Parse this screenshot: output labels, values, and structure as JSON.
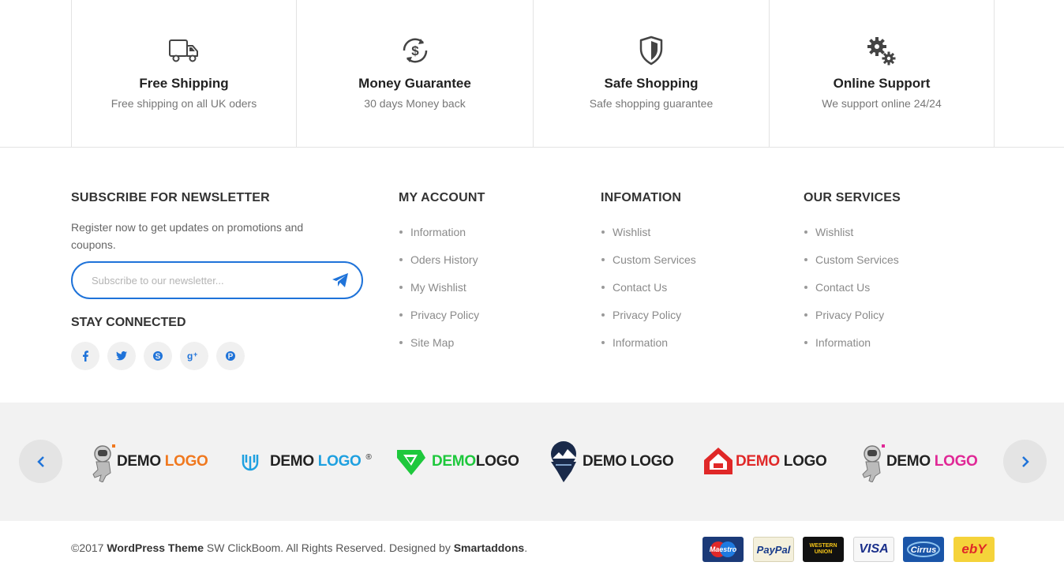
{
  "features": [
    {
      "title": "Free Shipping",
      "desc": "Free shipping on all UK oders",
      "icon": "truck-icon"
    },
    {
      "title": "Money Guarantee",
      "desc": "30 days Money back",
      "icon": "money-back-icon"
    },
    {
      "title": "Safe Shopping",
      "desc": "Safe shopping guarantee",
      "icon": "shield-icon"
    },
    {
      "title": "Online Support",
      "desc": "We support online 24/24",
      "icon": "gears-icon"
    }
  ],
  "newsletter": {
    "title": "SUBSCRIBE FOR NEWSLETTER",
    "text": "Register now to get updates on promotions and coupons.",
    "placeholder": "Subscribe to our newsletter...",
    "stay_connected": "STAY CONNECTED",
    "social": [
      "facebook-icon",
      "twitter-icon",
      "skype-icon",
      "google-plus-icon",
      "pinterest-icon"
    ]
  },
  "my_account": {
    "title": "MY ACCOUNT",
    "items": [
      "Information",
      "Oders History",
      "My Wishlist",
      "Privacy Policy",
      "Site Map"
    ]
  },
  "infomation": {
    "title": "INFOMATION",
    "items": [
      "Wishlist",
      "Custom Services",
      "Contact Us",
      "Privacy Policy",
      "Information"
    ]
  },
  "our_services": {
    "title": "OUR SERVICES",
    "items": [
      "Wishlist",
      "Custom Services",
      "Contact Us",
      "Privacy Policy",
      "Information"
    ]
  },
  "brands": [
    {
      "a": "DEMO ",
      "b": "LOGO",
      "color_a": "#222222",
      "color_b": "#f0781e"
    },
    {
      "a": "DEMO ",
      "b": "LOGO",
      "color_a": "#222222",
      "color_b": "#1ea0e0"
    },
    {
      "a": "DEMO",
      "b": "LOGO",
      "color_a": "#1ec83c",
      "color_b": "#222222"
    },
    {
      "a": "DEMO ",
      "b": "LOGO",
      "color_a": "#222222",
      "color_b": "#222222"
    },
    {
      "a": "DEMO ",
      "b": "LOGO",
      "color_a": "#e02828",
      "color_b": "#222222"
    },
    {
      "a": "DEMO ",
      "b": "LOGO",
      "color_a": "#222222",
      "color_b": "#e02896"
    }
  ],
  "copyright": {
    "prefix": "©2017 ",
    "theme": "WordPress Theme",
    "middle": " SW ClickBoom. All Rights Reserved. Designed by ",
    "designer": "Smartaddons",
    "suffix": "."
  },
  "payments": [
    "Maestro",
    "PayPal",
    "WESTERN UNION",
    "VISA",
    "Cirrus",
    "ebY"
  ],
  "colors": {
    "accent": "#1f73d9"
  }
}
